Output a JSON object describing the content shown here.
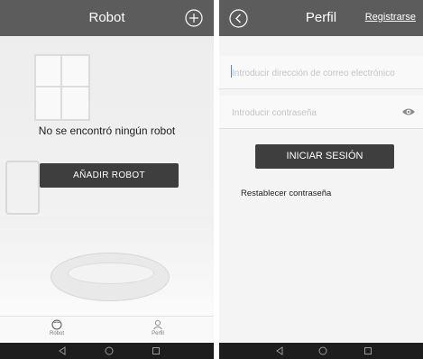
{
  "left_screen": {
    "header": {
      "title": "Robot",
      "add_icon": "plus-circle-icon"
    },
    "empty_message": "No se encontró ningún robot",
    "add_robot_button": "AÑADIR ROBOT",
    "tabs": [
      {
        "label": "Robot",
        "icon": "robot-icon",
        "selected": true
      },
      {
        "label": "Perfil",
        "icon": "user-icon",
        "selected": false
      }
    ],
    "nav_icons": [
      "back-triangle-icon",
      "home-circle-icon",
      "recents-square-icon"
    ]
  },
  "right_screen": {
    "header": {
      "title": "Perfil",
      "register_link": "Registrarse",
      "back_icon": "back-circle-icon"
    },
    "email_placeholder": "Introducir dirección de correo electrónico",
    "password_placeholder": "Introducir contraseña",
    "show_password_icon": "eye-icon",
    "login_button": "INICIAR SESIÓN",
    "reset_password_link": "Restablecer contraseña",
    "nav_icons": [
      "back-triangle-icon",
      "home-circle-icon",
      "recents-square-icon"
    ]
  },
  "colors": {
    "header": "#5c5c5c",
    "button": "#3e3e3e",
    "navbar": "#1d1d1d"
  }
}
